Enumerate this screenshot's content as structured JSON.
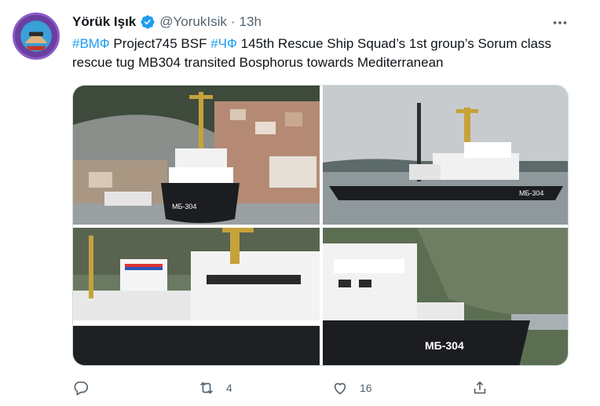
{
  "author": {
    "name": "Yörük Işık",
    "handle": "@YorukIsik",
    "time": "13h",
    "separator": "·",
    "avatar_icon": "profile-avatar-badge",
    "verified_icon": "verified-badge-icon"
  },
  "tweet": {
    "hashtag_1": "#ВМФ",
    "text_1": " Project745 BSF ",
    "hashtag_2": "#ЧФ",
    "text_2": " 145th Rescue Ship Squad’s 1st group’s Sorum class rescue tug MB304 transited Bosphorus towards Mediterranean"
  },
  "photos": {
    "photo_1_marking": "МБ-304",
    "photo_2_marking": "МБ-304",
    "photo_4_marking": "МБ-304"
  },
  "actions": {
    "reply_icon": "reply-icon",
    "retweet_icon": "retweet-icon",
    "retweet_count": "4",
    "like_icon": "heart-icon",
    "like_count": "16",
    "share_icon": "share-icon"
  },
  "colors": {
    "link": "#1d9bf0",
    "secondary_text": "#536471",
    "verified": "#1d9bf0"
  }
}
